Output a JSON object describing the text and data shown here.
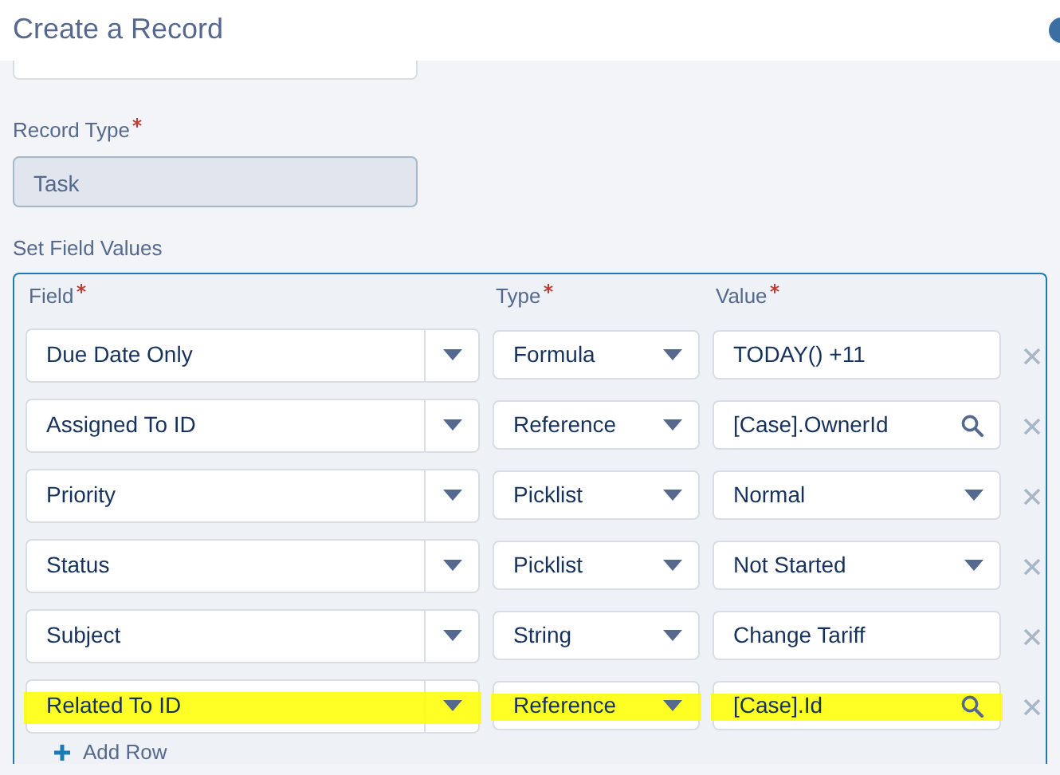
{
  "header": {
    "title": "Create a Record"
  },
  "record_type": {
    "label": "Record Type",
    "required": true,
    "value": "Task",
    "disabled": true
  },
  "field_values": {
    "label": "Set Field Values",
    "columns": [
      {
        "label": "Field",
        "required": true
      },
      {
        "label": "Type",
        "required": true
      },
      {
        "label": "Value",
        "required": true
      }
    ],
    "rows": [
      {
        "field": "Due Date Only",
        "type": "Formula",
        "value": "TODAY() +11",
        "kind": "text",
        "highlighted": false
      },
      {
        "field": "Assigned To ID",
        "type": "Reference",
        "value": "[Case].OwnerId",
        "kind": "lookup",
        "highlighted": false
      },
      {
        "field": "Priority",
        "type": "Picklist",
        "value": "Normal",
        "kind": "picklist",
        "highlighted": false
      },
      {
        "field": "Status",
        "type": "Picklist",
        "value": "Not Started",
        "kind": "picklist",
        "highlighted": false
      },
      {
        "field": "Subject",
        "type": "String",
        "value": "Change Tariff",
        "kind": "text",
        "highlighted": false
      },
      {
        "field": "Related To ID",
        "type": "Reference",
        "value": "[Case].Id",
        "kind": "lookup",
        "highlighted": true
      }
    ],
    "add_row": "Add Row"
  }
}
